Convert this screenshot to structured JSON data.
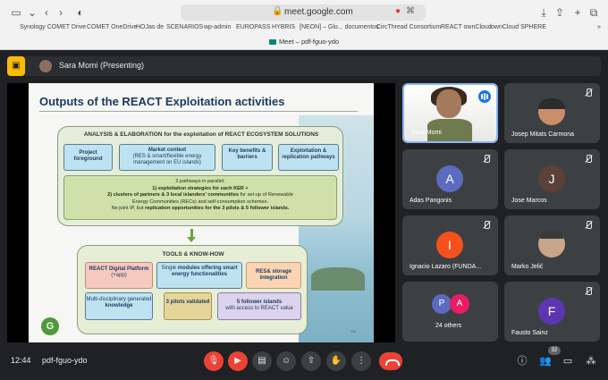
{
  "browser": {
    "url": "meet.google.com",
    "tab_title": "Meet – pdf-fguo-ydo",
    "bookmarks": [
      "Synology COMET Drive",
      "COMET OneDrive",
      "HOJas de",
      "SCENARIOS",
      "wp-admin",
      "EUROPASS",
      "HYBRIS",
      "[NEON] – Glo... documentos",
      "CircThread Consortium",
      "REACT ownCloud",
      "ownCloud SPHERE"
    ]
  },
  "presenting": {
    "label": "Sara Momi (Presenting)"
  },
  "slide": {
    "title": "Outputs of the REACT Exploitation activities",
    "analysis": {
      "title": "ANALYSIS & ELABORATION for the exploitation of REACT ECOSYSTEM SOLUTIONS",
      "boxes": [
        {
          "title": "Project foreground",
          "sub": ""
        },
        {
          "title": "Market context",
          "sub": "(RES & smart/flexible energy management on EU islands)"
        },
        {
          "title": "Key benefits & barriers",
          "sub": ""
        },
        {
          "title": "Exploitation & replication pathways",
          "sub": ""
        }
      ],
      "pathways": {
        "line1": "2 pathways in parallel:",
        "line2": "1) exploitation strategies for each KER +",
        "line3a": "2) clusters of partners & 3 local islanders' communities",
        "line3b": " for set-up of Renewable",
        "line4": "Energy Communities (RECs) and self-consumption schemes.",
        "line5a": "No joint IP, but ",
        "line5b": "replication opportunities for the 3 pilots & 5 follower islands."
      }
    },
    "tools": {
      "title": "TOOLS & KNOW-HOW",
      "boxes": [
        {
          "title": "REACT Digital Platform",
          "sub": "(+app)"
        },
        {
          "pre": "Single ",
          "title": "modules offering smart energy functionalities"
        },
        {
          "title": "RES& storage integration"
        },
        {
          "pre": "Multi-disciplinary generated ",
          "title": "knowledge"
        },
        {
          "title": "3 pilots validated"
        },
        {
          "title": "5 follower islands",
          "sub": "with access to REACT value"
        }
      ]
    },
    "photo_credit": "ISS",
    "logo_letter": "G"
  },
  "participants": [
    {
      "name": "Sara Momi",
      "type": "video",
      "speaking": true
    },
    {
      "name": "Josep Mitats Carmona",
      "type": "photo",
      "muted": true
    },
    {
      "name": "Adas Pangonis",
      "initial": "A",
      "color": "#5c6bc0",
      "muted": true
    },
    {
      "name": "Jose Marcos",
      "initial": "J",
      "color": "#5d4037",
      "muted": true
    },
    {
      "name": "Ignacio Lazaro (FUNDA...",
      "initial": "I",
      "color": "#f4511e",
      "muted": true
    },
    {
      "name": "Marko Jelić",
      "type": "photo",
      "muted": true
    },
    {
      "name": "24 others",
      "initials": [
        "P",
        "A"
      ],
      "colors": [
        "#5c6bc0",
        "#e91e63"
      ]
    },
    {
      "name": "Fausto Sainz",
      "initial": "F",
      "color": "#5e35b1",
      "muted": true
    }
  ],
  "controls": {
    "time": "12:44",
    "meeting_code": "pdf-fguo-ydo",
    "participant_count": "32"
  }
}
